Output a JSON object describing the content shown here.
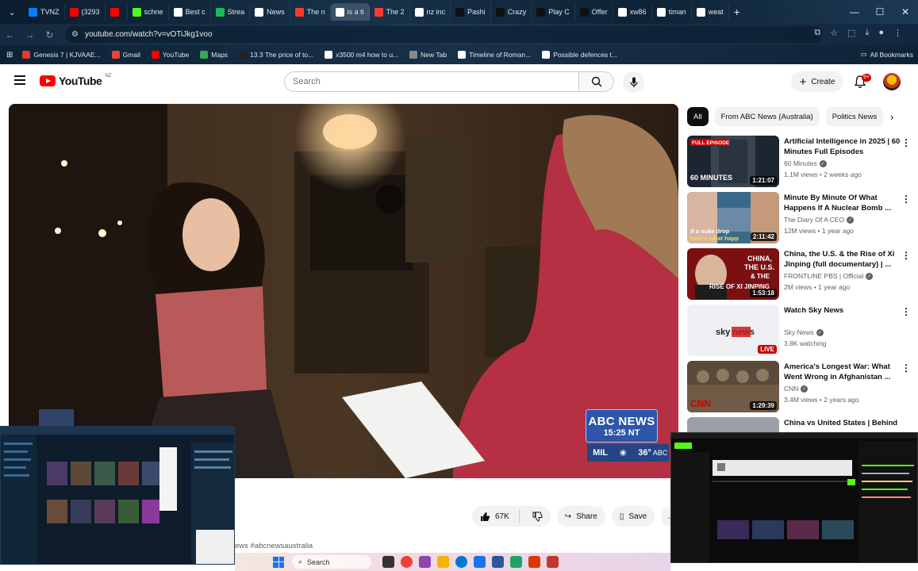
{
  "browser": {
    "tabs": [
      {
        "label": "TVNZ",
        "color": "#0a7cff"
      },
      {
        "label": "(3293",
        "color": "#ff0000"
      },
      {
        "label": "",
        "color": "#ff0000"
      },
      {
        "label": "schne",
        "color": "#53fc18"
      },
      {
        "label": "Best c",
        "color": "#ffffff"
      },
      {
        "label": "Strea",
        "color": "#1db954"
      },
      {
        "label": "News",
        "color": "#ffffff"
      },
      {
        "label": "The n",
        "color": "#ff3b30"
      },
      {
        "label": "is a ti",
        "color": "#ffffff",
        "active": true
      },
      {
        "label": "The 2",
        "color": "#ff3b30"
      },
      {
        "label": "nz inc",
        "color": "#ffffff"
      },
      {
        "label": "Pashi",
        "color": "#111111"
      },
      {
        "label": "Crazy",
        "color": "#111111"
      },
      {
        "label": "Play C",
        "color": "#111111"
      },
      {
        "label": "Offer",
        "color": "#111111"
      },
      {
        "label": "xw86",
        "color": "#ffffff"
      },
      {
        "label": "timan",
        "color": "#ffffff"
      },
      {
        "label": "weat",
        "color": "#ffffff"
      }
    ],
    "new_tab": "+",
    "tab_menu": "⌄",
    "url": "youtube.com/watch?v=vOTiJkg1voo",
    "window_controls": {
      "minimize": "—",
      "maximize": "☐",
      "close": "✕"
    },
    "bookmarks": [
      {
        "label": "Genesis 7 | KJVAAE...",
        "color": "#e53935"
      },
      {
        "label": "Gmail",
        "color": "#ea4335"
      },
      {
        "label": "YouTube",
        "color": "#ff0000"
      },
      {
        "label": "Maps",
        "color": "#34a853"
      },
      {
        "label": "13.3 The price of to...",
        "color": "#222222"
      },
      {
        "label": "x3500 m4 how to u...",
        "color": "#ffffff"
      },
      {
        "label": "New Tab",
        "color": "#888888"
      },
      {
        "label": "Timeline of Roman...",
        "color": "#ffffff"
      },
      {
        "label": "Possible defences t...",
        "color": "#ffffff"
      }
    ],
    "all_bookmarks": "All Bookmarks"
  },
  "youtube": {
    "logo_text": "YouTube",
    "country_code": "NZ",
    "search_placeholder": "Search",
    "create_label": "Create",
    "notification_count": "9+",
    "video": {
      "news_brand": "ABC NEWS",
      "news_time": "15:25 NT",
      "weather_city": "MIL",
      "weather_temp": "36°",
      "channel_mark": "ABC"
    },
    "actions": {
      "like_count": "67K",
      "share_label": "Share",
      "save_label": "Save",
      "more_label": "..."
    },
    "description_tag": "ews #abcnewsaustralia",
    "chips": [
      {
        "label": "All",
        "active": true
      },
      {
        "label": "From ABC News (Australia)",
        "active": false
      },
      {
        "label": "Politics News",
        "active": false
      }
    ],
    "recommendations": [
      {
        "title": "Artificial Intelligence in 2025 | 60 Minutes Full Episodes",
        "channel": "60 Minutes",
        "meta": "1.1M views • 2 weeks ago",
        "duration": "1:21:07",
        "badge": "FULL EPISODE"
      },
      {
        "title": "Minute By Minute Of What Happens If A Nuclear Bomb ...",
        "channel": "The Diary Of A CEO",
        "meta": "12M views • 1 year ago",
        "duration": "2:11:42",
        "badge": ""
      },
      {
        "title": "China, the U.S. & the Rise of Xi Jinping (full documentary) | ...",
        "channel": "FRONTLINE PBS | Official",
        "meta": "2M views • 1 year ago",
        "duration": "1:53:18",
        "badge": ""
      },
      {
        "title": "Watch Sky News",
        "channel": "Sky News",
        "meta": "3.8K watching",
        "duration": "LIVE",
        "badge": ""
      },
      {
        "title": "America's Longest War: What Went Wrong in Afghanistan ...",
        "channel": "CNN",
        "meta": "3.4M views • 2 years ago",
        "duration": "1:29:39",
        "badge": ""
      },
      {
        "title": "China vs United States | Behind",
        "channel": "",
        "meta": "",
        "duration": "",
        "badge": ""
      }
    ]
  },
  "taskbar": {
    "search_label": "Search"
  },
  "thumb_text": {
    "thumb1": "60 MINUTES",
    "thumb2_a": "if a nuke drop",
    "thumb2_b": "here's what happ",
    "thumb3_a": "CHINA,",
    "thumb3_b": "THE U.S.",
    "thumb3_c": "& THE",
    "thumb3_d": "RISE OF XI JINPING",
    "thumb4": "sky news",
    "thumb5": "CNN"
  }
}
